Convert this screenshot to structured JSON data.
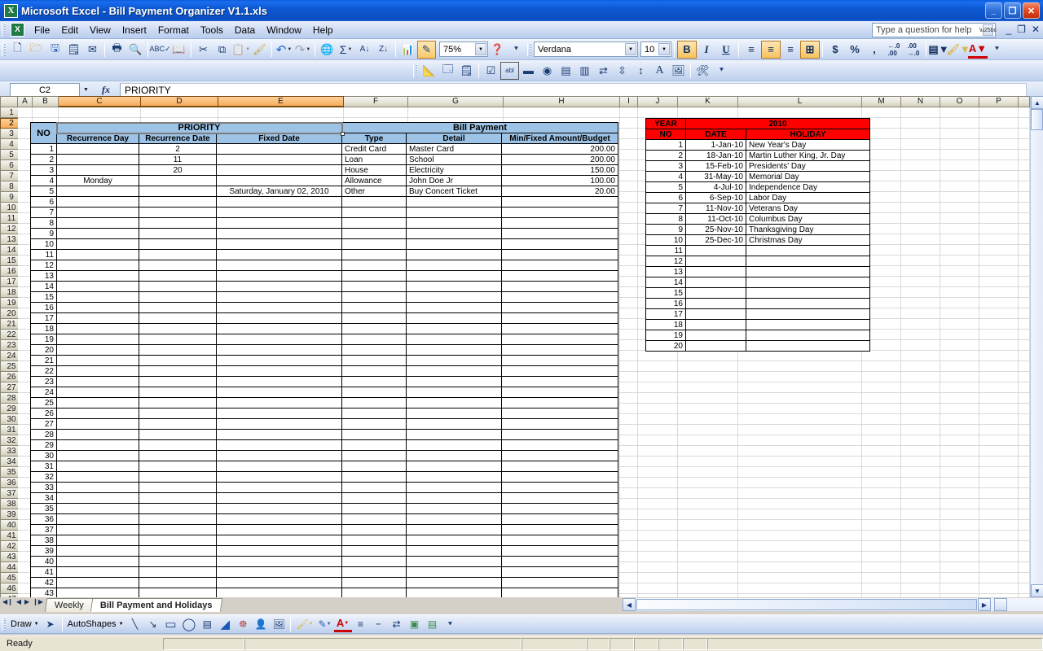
{
  "window": {
    "title": "Microsoft Excel - Bill Payment Organizer V1.1.xls",
    "app_icon": "excel-icon",
    "minimize": "_",
    "restore": "❐",
    "close": "✕"
  },
  "menubar": {
    "items": [
      "File",
      "Edit",
      "View",
      "Insert",
      "Format",
      "Tools",
      "Data",
      "Window",
      "Help"
    ],
    "ask_box_placeholder": "Type a question for help",
    "doc_minimize": "_",
    "doc_restore": "❐",
    "doc_close": "✕"
  },
  "toolbar": {
    "standard": [
      {
        "name": "new-icon",
        "glyph": "⬜"
      },
      {
        "name": "open-icon",
        "glyph": "📂"
      },
      {
        "name": "save-icon",
        "glyph": "💾"
      },
      {
        "name": "permission-icon",
        "glyph": "📋"
      },
      {
        "name": "email-icon",
        "glyph": "✉"
      },
      {
        "name": "print-icon",
        "glyph": "🖨"
      },
      {
        "name": "print-preview-icon",
        "glyph": "🔍"
      },
      {
        "name": "spelling-icon",
        "glyph": "ABC"
      },
      {
        "name": "research-icon",
        "glyph": "📖"
      },
      {
        "name": "cut-icon",
        "glyph": "✂"
      },
      {
        "name": "copy-icon",
        "glyph": "⧉"
      },
      {
        "name": "paste-icon",
        "glyph": "📋"
      },
      {
        "name": "format-painter-icon",
        "glyph": "🖌"
      },
      {
        "name": "undo-icon",
        "glyph": "↶"
      },
      {
        "name": "redo-icon",
        "glyph": "↷"
      },
      {
        "name": "hyperlink-icon",
        "glyph": "🌐"
      },
      {
        "name": "autosum-icon",
        "glyph": "Σ"
      },
      {
        "name": "sort-ascending-icon",
        "glyph": "A↓"
      },
      {
        "name": "sort-descending-icon",
        "glyph": "Z↓"
      },
      {
        "name": "chart-wizard-icon",
        "glyph": "📊"
      },
      {
        "name": "drawing-icon",
        "glyph": "✏"
      }
    ],
    "zoom_value": "75%",
    "help_icon": "❓",
    "font_name": "Verdana",
    "font_size": "10",
    "bold_label": "B",
    "italic_label": "I",
    "underline_label": "U",
    "align_left_icon": "≡",
    "align_center_icon": "≡",
    "align_right_icon": "≡",
    "merge_center_icon": "⊞",
    "currency_label": "$",
    "percent_label": "%",
    "comma_label": ",",
    "increase_decimal_label": ".00",
    "decrease_decimal_label": ".00",
    "borders_icon": "▤",
    "fill_color_icon": "🪣",
    "font_color_label": "A",
    "toolbar_options_icon": "»",
    "forms": [
      {
        "name": "design-mode-icon",
        "glyph": "📐"
      },
      {
        "name": "properties-icon",
        "glyph": "📄"
      },
      {
        "name": "view-code-icon",
        "glyph": "🗒"
      },
      {
        "name": "check-box-icon",
        "glyph": "☑"
      },
      {
        "name": "text-box-icon",
        "glyph": "abl"
      },
      {
        "name": "command-button-icon",
        "glyph": "▬"
      },
      {
        "name": "option-button-icon",
        "glyph": "◉"
      },
      {
        "name": "list-box-icon",
        "glyph": "☰"
      },
      {
        "name": "combo-box-icon",
        "glyph": "▤"
      },
      {
        "name": "toggle-button-icon",
        "glyph": "⇄"
      },
      {
        "name": "spin-button-icon",
        "glyph": "⇅"
      },
      {
        "name": "scroll-bar-icon",
        "glyph": "↕"
      },
      {
        "name": "label-icon",
        "glyph": "A"
      },
      {
        "name": "image-icon",
        "glyph": "🖼"
      },
      {
        "name": "more-controls-icon",
        "glyph": "🛠"
      }
    ]
  },
  "formula_bar": {
    "name_box": "C2",
    "fx_label": "fx",
    "formula_value": "PRIORITY"
  },
  "grid": {
    "column_headers": [
      "A",
      "B",
      "C",
      "D",
      "E",
      "F",
      "G",
      "H",
      "I",
      "J",
      "K",
      "L",
      "M",
      "N",
      "O",
      "P"
    ],
    "selected_columns": [
      "C",
      "D",
      "E"
    ],
    "selected_row": "2",
    "row_count_visible": 47
  },
  "priority_table": {
    "no_header": "NO",
    "group_header": "PRIORITY",
    "columns": [
      "Recurrence Day",
      "Recurrence Date",
      "Fixed Date"
    ],
    "rows": [
      {
        "no": "1",
        "recurrence_day": "",
        "recurrence_date": "2",
        "fixed_date": ""
      },
      {
        "no": "2",
        "recurrence_day": "",
        "recurrence_date": "11",
        "fixed_date": ""
      },
      {
        "no": "3",
        "recurrence_day": "",
        "recurrence_date": "20",
        "fixed_date": ""
      },
      {
        "no": "4",
        "recurrence_day": "Monday",
        "recurrence_date": "",
        "fixed_date": ""
      },
      {
        "no": "5",
        "recurrence_day": "",
        "recurrence_date": "",
        "fixed_date": "Saturday, January 02, 2010"
      }
    ],
    "empty_row_numbers": [
      "6",
      "7",
      "8",
      "9",
      "10",
      "11",
      "12",
      "13",
      "14",
      "15",
      "16",
      "17",
      "18",
      "19",
      "20",
      "21",
      "22",
      "23",
      "24",
      "25",
      "26",
      "27",
      "28",
      "29",
      "30",
      "31",
      "32",
      "33",
      "34",
      "35",
      "36",
      "37",
      "38",
      "39",
      "40",
      "41",
      "42",
      "43"
    ]
  },
  "bill_payment_table": {
    "group_header": "Bill Payment",
    "columns": [
      "Type",
      "Detail",
      "Min/Fixed Amount/Budget"
    ],
    "rows": [
      {
        "type": "Credit Card",
        "detail": "Master Card",
        "amount": "200.00"
      },
      {
        "type": "Loan",
        "detail": "School",
        "amount": "200.00"
      },
      {
        "type": "House",
        "detail": "Electricity",
        "amount": "150.00"
      },
      {
        "type": "Allowance",
        "detail": "John Doe Jr",
        "amount": "100.00"
      },
      {
        "type": "Other",
        "detail": "Buy Concert Ticket",
        "amount": "20.00"
      }
    ]
  },
  "holiday_table": {
    "year_label": "YEAR",
    "year_value": "2010",
    "columns": [
      "NO",
      "DATE",
      "HOLIDAY"
    ],
    "rows": [
      {
        "no": "1",
        "date": "1-Jan-10",
        "holiday": "New Year's Day"
      },
      {
        "no": "2",
        "date": "18-Jan-10",
        "holiday": "Martin Luther King, Jr. Day"
      },
      {
        "no": "3",
        "date": "15-Feb-10",
        "holiday": "Presidents' Day"
      },
      {
        "no": "4",
        "date": "31-May-10",
        "holiday": "Memorial Day"
      },
      {
        "no": "5",
        "date": "4-Jul-10",
        "holiday": "Independence Day"
      },
      {
        "no": "6",
        "date": "6-Sep-10",
        "holiday": "Labor Day"
      },
      {
        "no": "7",
        "date": "11-Nov-10",
        "holiday": "Veterans Day"
      },
      {
        "no": "8",
        "date": "11-Oct-10",
        "holiday": "Columbus Day"
      },
      {
        "no": "9",
        "date": "25-Nov-10",
        "holiday": "Thanksgiving Day"
      },
      {
        "no": "10",
        "date": "25-Dec-10",
        "holiday": "Christmas Day"
      },
      {
        "no": "11",
        "date": "",
        "holiday": ""
      },
      {
        "no": "12",
        "date": "",
        "holiday": ""
      },
      {
        "no": "13",
        "date": "",
        "holiday": ""
      },
      {
        "no": "14",
        "date": "",
        "holiday": ""
      },
      {
        "no": "15",
        "date": "",
        "holiday": ""
      },
      {
        "no": "16",
        "date": "",
        "holiday": ""
      },
      {
        "no": "17",
        "date": "",
        "holiday": ""
      },
      {
        "no": "18",
        "date": "",
        "holiday": ""
      },
      {
        "no": "19",
        "date": "",
        "holiday": ""
      },
      {
        "no": "20",
        "date": "",
        "holiday": ""
      }
    ]
  },
  "sheet_tabs": {
    "first_icon": "◀❙",
    "prev_icon": "◀",
    "next_icon": "▶",
    "last_icon": "❙▶",
    "tabs": [
      {
        "label": "Weekly",
        "active": false
      },
      {
        "label": "Bill Payment and Holidays",
        "active": true
      }
    ]
  },
  "drawing_toolbar": {
    "draw_label": "Draw",
    "select_icon": "➤",
    "autoshapes_label": "AutoShapes",
    "line_icon": "╲",
    "arrow_icon": "↘",
    "rectangle_icon": "▭",
    "oval_icon": "◯",
    "textbox_icon": "▤",
    "wordart_icon": "✑",
    "diagram_icon": "☸",
    "clipart_icon": "👤",
    "picture_icon": "🖼",
    "fill_color_icon": "🪣",
    "line_color_icon": "✏",
    "font_color_label": "A",
    "line_style_icon": "≡",
    "dash_style_icon": "┉",
    "arrow_style_icon": "⇄",
    "shadow_style_icon": "■",
    "3d_style_icon": "▣"
  },
  "status_bar": {
    "status_text": "Ready"
  },
  "colors": {
    "title_blue": "#0b4fc2",
    "header_blue": "#9dc3e6",
    "header_red": "#ff0000",
    "column_select_orange": "#f7ad5c",
    "grid_line": "#d9d9d9"
  }
}
